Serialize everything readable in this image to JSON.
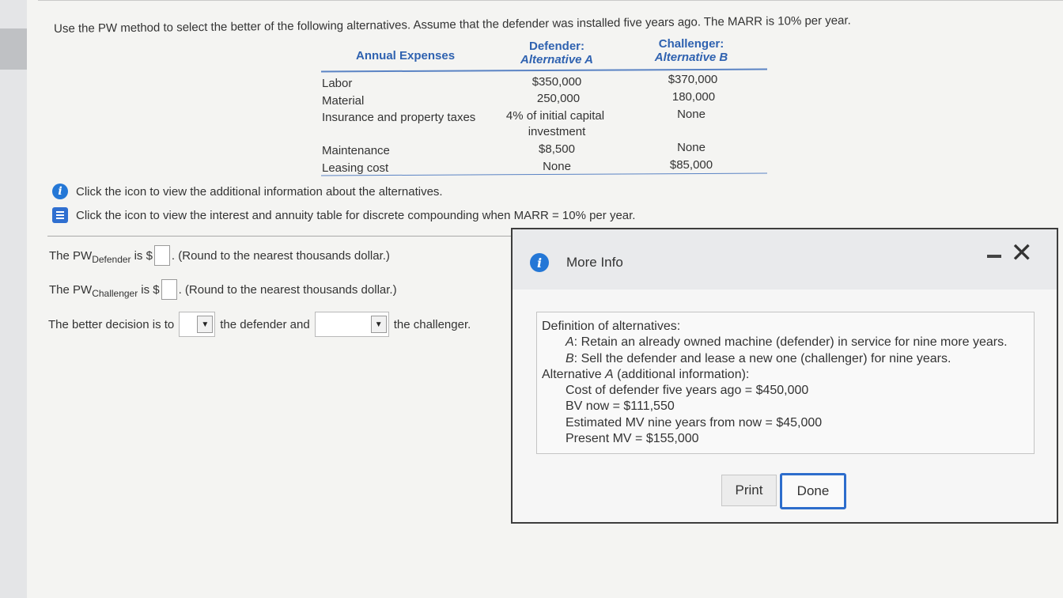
{
  "question": "Use the PW method to select the better of the following alternatives. Assume that the defender was installed five years ago. The MARR is 10% per year.",
  "table": {
    "header": {
      "expenses": "Annual Expenses",
      "defender_line1": "Defender:",
      "defender_line2": "Alternative A",
      "challenger_line1": "Challenger:",
      "challenger_line2": "Alternative B"
    },
    "rows": [
      {
        "label": "Labor",
        "defender": "$350,000",
        "challenger": "$370,000"
      },
      {
        "label": "Material",
        "defender": "250,000",
        "challenger": "180,000"
      },
      {
        "label": "Insurance and property taxes",
        "defender": "4% of initial capital",
        "defender2": "investment",
        "challenger": "None"
      },
      {
        "label": "Maintenance",
        "defender": "$8,500",
        "challenger": "None"
      },
      {
        "label": "Leasing cost",
        "defender": "None",
        "challenger": "$85,000"
      }
    ]
  },
  "info_links": {
    "additional": "Click the icon to view the additional information about the alternatives.",
    "table": "Click the icon to view the interest and annuity table for discrete compounding when MARR = 10% per year."
  },
  "questions": {
    "pw_prefix": "The PW",
    "defender_sub": "Defender",
    "challenger_sub": "Challenger",
    "is_dollar": "is $",
    "round_note": ". (Round to the nearest thousands dollar.)",
    "decision_prefix": "The better decision is to",
    "decision_mid": "the defender and",
    "decision_suffix": "the challenger."
  },
  "modal": {
    "title": "More Info",
    "def_heading": "Definition of alternatives:",
    "a_key": "A",
    "a_text": ": Retain an already owned machine (defender) in service for nine more years.",
    "b_key": "B",
    "b_text": ": Sell the defender and lease a new one (challenger) for nine years.",
    "alt_prefix": "Alternative ",
    "alt_key": "A",
    "alt_suffix": " (additional information):",
    "cost": "Cost of defender five years ago = $450,000",
    "bv": "BV now = $111,550",
    "mv_future": "Estimated MV nine years from now = $45,000",
    "mv_present": "Present MV = $155,000",
    "print_label": "Print",
    "done_label": "Done"
  },
  "colors": {
    "accent": "#2f62b0",
    "info_icon": "#2477d6",
    "done_border": "#2d6dcc"
  },
  "icons": [
    "info-icon",
    "book-icon",
    "minimize-icon",
    "close-icon",
    "dropdown-arrow-icon"
  ]
}
